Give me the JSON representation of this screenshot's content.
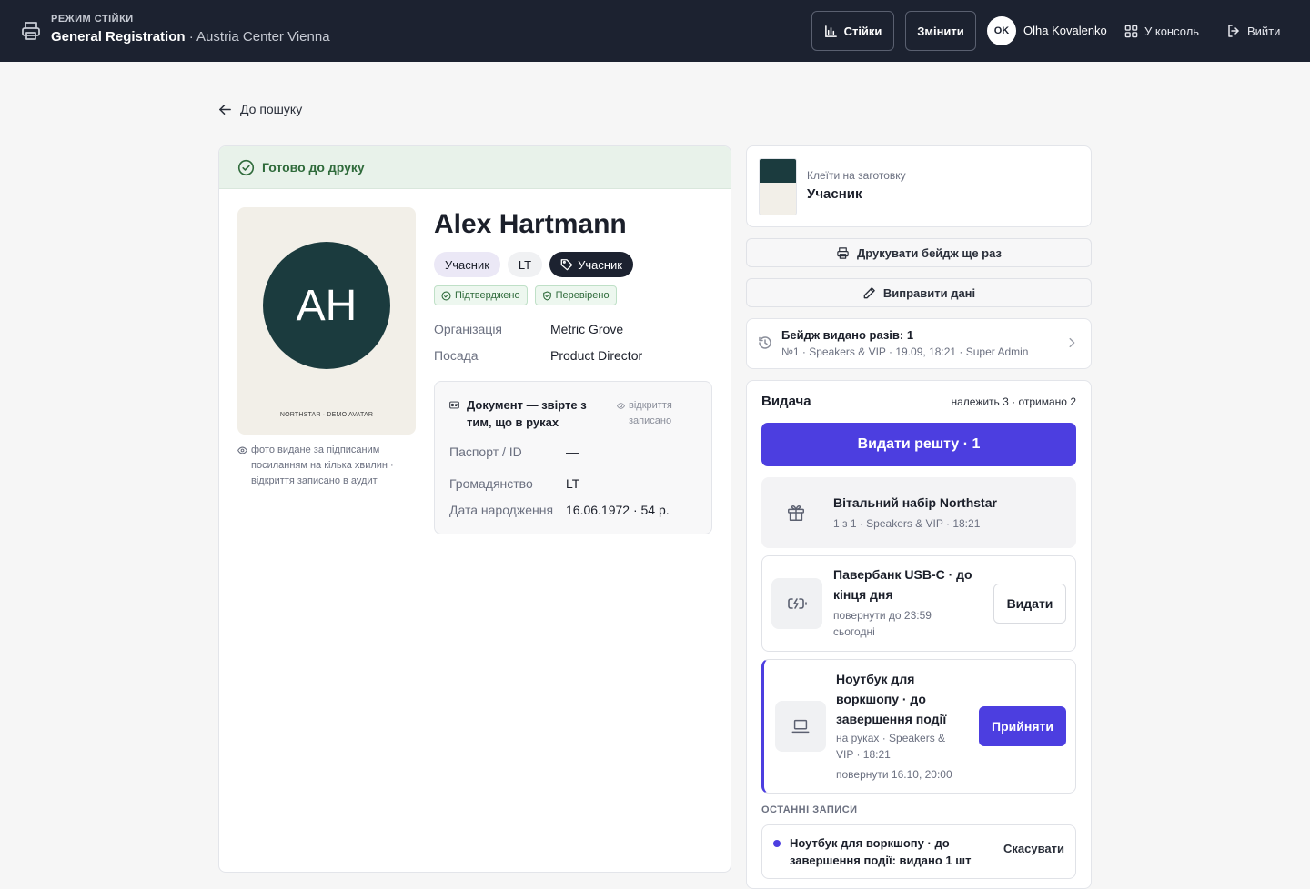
{
  "topbar": {
    "mode_label": "РЕЖИМ СТІЙКИ",
    "event_name": "General Registration",
    "venue": "· Austria Center Vienna",
    "stands_label": "Стійки",
    "change_label": "Змінити",
    "user_initials": "OK",
    "user_name": "Olha Kovalenko",
    "console_label": "У консоль",
    "logout_label": "Вийти"
  },
  "back_label": "До пошуку",
  "status": {
    "ready_label": "Готово до друку"
  },
  "attendee": {
    "initials": "AH",
    "photo_caption": "NORTHSTAR · DEMO AVATAR",
    "photo_note": "фото видане за підписаним посиланням на кілька хвилин · відкриття записано в аудит",
    "name": "Alex Hartmann",
    "role_chip": "Учасник",
    "lang_chip": "LT",
    "tag_chip": "Учасник",
    "confirmed_label": "Підтверджено",
    "verified_label": "Перевірено",
    "org_label": "Організація",
    "org_value": "Metric Grove",
    "position_label": "Посада",
    "position_value": "Product Director"
  },
  "document": {
    "title": "Документ — звірте з тим, що в руках",
    "opening_recorded": "відкриття записано",
    "passport_label": "Паспорт / ID",
    "passport_value": "—",
    "citizenship_label": "Громадянство",
    "citizenship_value": "LT",
    "birth_label": "Дата народження",
    "birth_value": "16.06.1972 · 54 р."
  },
  "template": {
    "label": "Клеїти на заготовку",
    "value": "Учасник"
  },
  "actions": {
    "reprint_label": "Друкувати бейдж ще раз",
    "edit_label": "Виправити дані"
  },
  "history": {
    "title": "Бейдж видано разів: 1",
    "subtitle": "№1 · Speakers & VIP · 19.09, 18:21 · Super Admin"
  },
  "issuance": {
    "title": "Видача",
    "counts": "належить 3 · отримано 2",
    "primary_label": "Видати решту · 1",
    "items": [
      {
        "name": "Вітальний набір Northstar",
        "sub": "1 з 1 · Speakers & VIP · 18:21"
      },
      {
        "name": "Павербанк USB-C · до кінця дня",
        "sub": "повернути до 23:59 сьогодні",
        "action": "Видати"
      },
      {
        "name": "Ноутбук для воркшопу · до завершення події",
        "sub": "на руках · Speakers & VIP · 18:21",
        "sub2": "повернути 16.10, 20:00",
        "action": "Прийняти"
      }
    ],
    "recent_heading": "ОСТАННІ ЗАПИСИ",
    "recent": [
      {
        "text": "Ноутбук для воркшопу · до завершення події: видано 1 шт",
        "action": "Скасувати"
      }
    ]
  },
  "colors": {
    "accent": "#4c3ee0",
    "topbar": "#1c2230",
    "success": "#2f6b3b"
  }
}
